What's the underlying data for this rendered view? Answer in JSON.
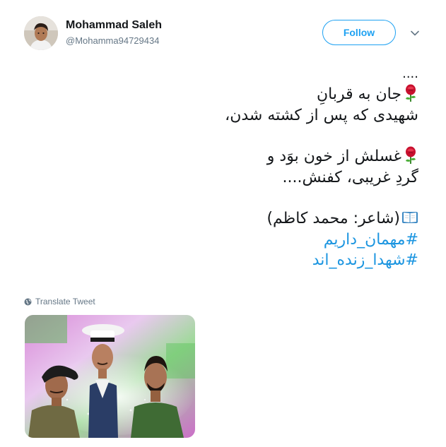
{
  "user": {
    "name": "Mohammad Saleh",
    "handle": "@Mohamma94729434"
  },
  "follow": {
    "label": "Follow"
  },
  "tweet": {
    "dots": "....",
    "line1": "جان به قربانِ",
    "line2": "شهیدی که پس از کشته شدن،",
    "line3": "غسلش از خون بوَد و",
    "line4": "گردِ غریبی، کفنش....",
    "credit": "(شاعر: محمد کاظم)",
    "hashtag1": "#مهمان_داریم",
    "hashtag2": "#شهدا_زنده_اند"
  },
  "translate": {
    "label": "Translate Tweet"
  },
  "icons": {
    "rose": "rose-icon",
    "book": "open-book-icon",
    "globe": "globe-icon",
    "caret": "chevron-down-icon"
  },
  "colors": {
    "accent": "#1da1f2",
    "hashtag": "#1b95e0",
    "secondary_text": "#657786",
    "primary_text": "#14171a"
  }
}
